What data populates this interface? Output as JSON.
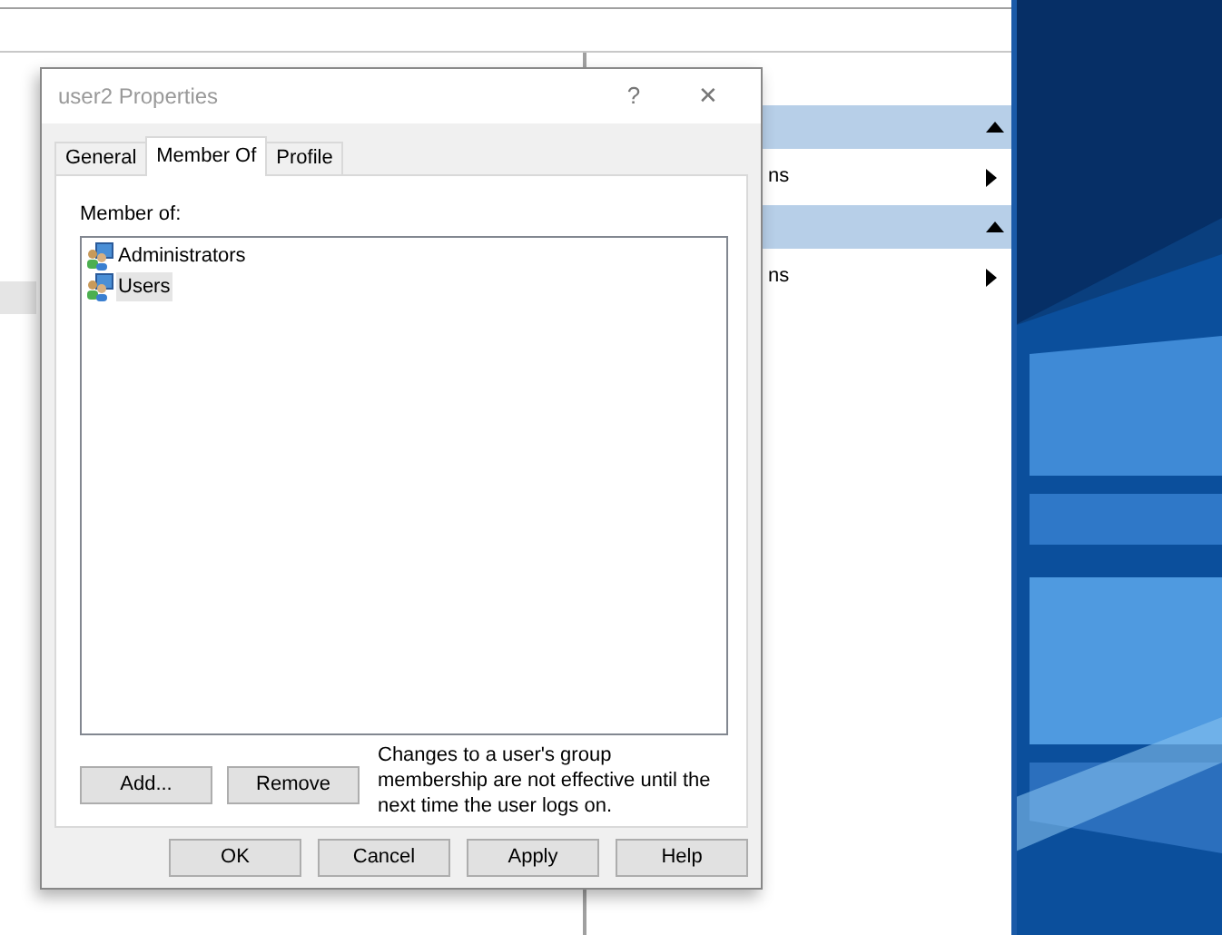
{
  "background_window": {
    "actions": [
      {
        "label": "ns"
      },
      {
        "label": "ns"
      }
    ]
  },
  "dialog": {
    "title": "user2 Properties",
    "help_button": "?",
    "close_button": "✕",
    "tabs": [
      {
        "label": "General",
        "selected": false
      },
      {
        "label": "Member Of",
        "selected": true
      },
      {
        "label": "Profile",
        "selected": false
      }
    ],
    "list_label": "Member of:",
    "groups": [
      {
        "name": "Administrators",
        "selected": false
      },
      {
        "name": "Users",
        "selected": true
      }
    ],
    "buttons": [
      "Add...",
      "Remove"
    ],
    "note": "Changes to a user's group membership are not effective until the next time the user logs on.",
    "footer_buttons": [
      "OK",
      "Cancel",
      "Apply",
      "Help"
    ]
  }
}
